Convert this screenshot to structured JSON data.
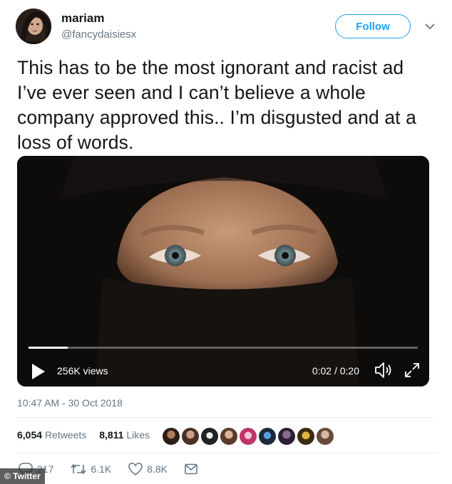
{
  "user": {
    "display_name": "mariam",
    "handle": "@fancydaisiesx",
    "avatar_icon": "profile-photo"
  },
  "follow_label": "Follow",
  "menu_icon": "chevron-down-icon",
  "tweet_text": "This has to be the most ignorant and racist ad I’ve ever seen and I can’t believe a whole company approved this.. I’m disgusted and at a loss of words.",
  "video": {
    "views": "256K views",
    "time": "0:02 / 0:20",
    "progress": 0.1
  },
  "timestamp": "10:47 AM - 30 Oct 2018",
  "stats": {
    "retweets_count": "6,054",
    "retweets_label": "Retweets",
    "likes_count": "8,811",
    "likes_label": "Likes"
  },
  "actions": {
    "replies": "217",
    "retweets": "6.1K",
    "likes": "8.8K"
  },
  "watermark": "© Twitter",
  "colors": {
    "accent": "#1da1f2",
    "secondary_text": "#657786",
    "primary_text": "#14171a"
  }
}
